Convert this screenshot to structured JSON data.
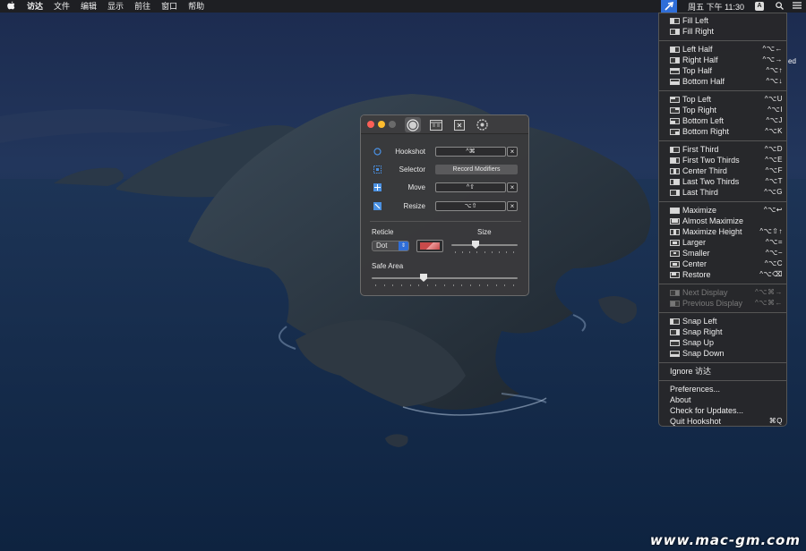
{
  "menubar": {
    "items": [
      "访达",
      "文件",
      "编辑",
      "显示",
      "前往",
      "窗口",
      "帮助"
    ],
    "clock": "周五 下午 11:30",
    "input_label": "A"
  },
  "desktop": {
    "partial_label": "ed"
  },
  "dropdown": {
    "groups": [
      [
        {
          "label": "Fill Left",
          "shortcut": "",
          "icon": "fill-left"
        },
        {
          "label": "Fill Right",
          "shortcut": "",
          "icon": "fill-right"
        }
      ],
      [
        {
          "label": "Left Half",
          "shortcut": "^⌥←",
          "icon": "left-half"
        },
        {
          "label": "Right Half",
          "shortcut": "^⌥→",
          "icon": "right-half"
        },
        {
          "label": "Top Half",
          "shortcut": "^⌥↑",
          "icon": "top-half"
        },
        {
          "label": "Bottom Half",
          "shortcut": "^⌥↓",
          "icon": "bottom-half"
        }
      ],
      [
        {
          "label": "Top Left",
          "shortcut": "^⌥U",
          "icon": "top-left"
        },
        {
          "label": "Top Right",
          "shortcut": "^⌥I",
          "icon": "top-right"
        },
        {
          "label": "Bottom Left",
          "shortcut": "^⌥J",
          "icon": "bottom-left"
        },
        {
          "label": "Bottom Right",
          "shortcut": "^⌥K",
          "icon": "bottom-right"
        }
      ],
      [
        {
          "label": "First Third",
          "shortcut": "^⌥D",
          "icon": "first-third"
        },
        {
          "label": "First Two Thirds",
          "shortcut": "^⌥E",
          "icon": "first-two-thirds"
        },
        {
          "label": "Center Third",
          "shortcut": "^⌥F",
          "icon": "center-third"
        },
        {
          "label": "Last Two Thirds",
          "shortcut": "^⌥T",
          "icon": "last-two-thirds"
        },
        {
          "label": "Last Third",
          "shortcut": "^⌥G",
          "icon": "last-third"
        }
      ],
      [
        {
          "label": "Maximize",
          "shortcut": "^⌥↩",
          "icon": "maximize"
        },
        {
          "label": "Almost Maximize",
          "shortcut": "",
          "icon": "almost-maximize"
        },
        {
          "label": "Maximize Height",
          "shortcut": "^⌥⇧↑",
          "icon": "maximize-height"
        },
        {
          "label": "Larger",
          "shortcut": "^⌥=",
          "icon": "larger"
        },
        {
          "label": "Smaller",
          "shortcut": "^⌥−",
          "icon": "smaller"
        },
        {
          "label": "Center",
          "shortcut": "^⌥C",
          "icon": "center"
        },
        {
          "label": "Restore",
          "shortcut": "^⌥⌫",
          "icon": "restore"
        }
      ],
      [
        {
          "label": "Next Display",
          "shortcut": "^⌥⌘→",
          "icon": "next-display",
          "disabled": true
        },
        {
          "label": "Previous Display",
          "shortcut": "^⌥⌘←",
          "icon": "previous-display",
          "disabled": true
        }
      ],
      [
        {
          "label": "Snap Left",
          "shortcut": "",
          "icon": "snap-left"
        },
        {
          "label": "Snap Right",
          "shortcut": "",
          "icon": "snap-right"
        },
        {
          "label": "Snap Up",
          "shortcut": "",
          "icon": "snap-up"
        },
        {
          "label": "Snap Down",
          "shortcut": "",
          "icon": "snap-down"
        }
      ],
      [
        {
          "label": "Ignore 访达",
          "shortcut": ""
        }
      ],
      [
        {
          "label": "Preferences...",
          "shortcut": ""
        },
        {
          "label": "About",
          "shortcut": ""
        },
        {
          "label": "Check for Updates...",
          "shortcut": ""
        },
        {
          "label": "Quit Hookshot",
          "shortcut": "⌘Q"
        }
      ]
    ]
  },
  "prefs": {
    "rows": [
      {
        "label": "Hookshot",
        "value": "^⌘",
        "icon": "circle-icon"
      },
      {
        "label": "Selector",
        "value": "Record Modifiers",
        "icon": "selector-icon"
      },
      {
        "label": "Move",
        "value": "^⇧",
        "icon": "move-icon"
      },
      {
        "label": "Resize",
        "value": "⌥⇧",
        "icon": "resize-icon"
      }
    ],
    "clear_glyph": "×",
    "reticle_label": "Reticle",
    "size_label": "Size",
    "reticle_value": "Dot",
    "size_level": 0.35,
    "safe_area_label": "Safe Area",
    "safe_area_level": 0.35,
    "colors": {
      "reticle": "#c84a4a",
      "accent": "#2f6ed8"
    }
  },
  "watermark": "www.mac-gm.com"
}
